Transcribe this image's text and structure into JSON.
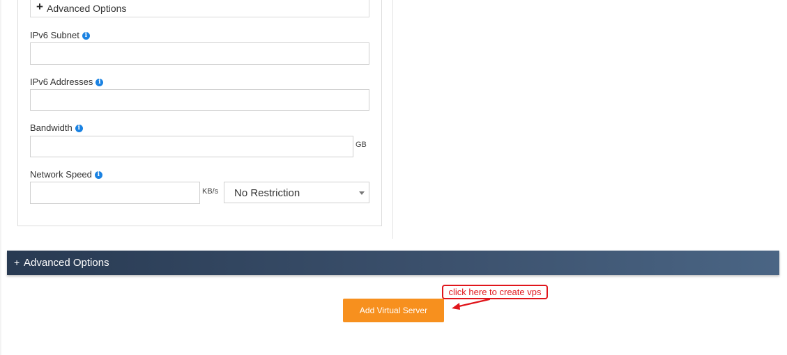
{
  "advanced_options_collapsed": {
    "icon": "plus-icon",
    "label": "Advanced Options"
  },
  "fields": {
    "ipv6_subnet": {
      "label": "IPv6 Subnet",
      "value": "",
      "info_icon": "info-icon"
    },
    "ipv6_addresses": {
      "label": "IPv6 Addresses",
      "value": "",
      "info_icon": "info-icon"
    },
    "bandwidth": {
      "label": "Bandwidth",
      "value": "",
      "unit": "GB",
      "info_icon": "info-icon"
    },
    "network_speed": {
      "label": "Network Speed",
      "value": "",
      "unit": "KB/s",
      "info_icon": "info-icon",
      "restriction_selected": "No Restriction"
    }
  },
  "advanced_bar": {
    "icon": "+",
    "label": "Advanced Options"
  },
  "add_button": {
    "label": "Add Virtual Server",
    "color": "#f7901e"
  },
  "annotation": {
    "text": "click here to create vps",
    "color": "#e0151b"
  },
  "colors": {
    "info": "#1a82e2",
    "bar_start": "#283a52",
    "bar_end": "#4a6584"
  }
}
